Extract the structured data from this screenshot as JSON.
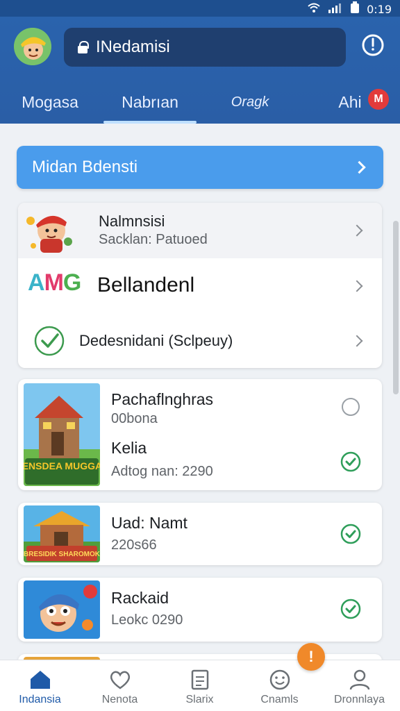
{
  "status_bar": {
    "time": "0:19"
  },
  "app_bar": {
    "url": "INedamisi"
  },
  "tabs": [
    {
      "label": "Mogasa"
    },
    {
      "label": "Nabrıan"
    },
    {
      "label": "Oragk"
    },
    {
      "label": "Ahi",
      "badge": "M"
    }
  ],
  "banner": {
    "label": "Midan Bdensti"
  },
  "list": {
    "items": [
      {
        "title": "Nalmnsisi",
        "subtitle": "Sacklan: Patuoed"
      },
      {
        "logo": "AMG",
        "title": "Bellandenl"
      },
      {
        "title": "Dedesnidani (Sclpeuy)"
      }
    ]
  },
  "games": [
    {
      "title": "Pachaflnghras",
      "subtitle": "00bona",
      "title2": "Kelia",
      "subtitle2": "Adtog nan: 2290",
      "image_text": "KENSDEA MUGGAS",
      "selected_top": false,
      "selected_bottom": true
    },
    {
      "title": "Uad: Namt",
      "subtitle": "220s66",
      "image_text": "BRESIDIK SHAROMOK",
      "selected": true
    },
    {
      "title": "Rackaid",
      "subtitle": "Leokc 0290",
      "selected": true
    }
  ],
  "fab": {
    "label": "!"
  },
  "bottom_nav": [
    {
      "label": "Indansia"
    },
    {
      "label": "Nenota"
    },
    {
      "label": "Slarix"
    },
    {
      "label": "Cnamls"
    },
    {
      "label": "Dronnlaya"
    }
  ],
  "colors": {
    "primary": "#2a63ad",
    "accent": "#4a9cec",
    "success": "#2f9e5a",
    "warning": "#f0892a"
  }
}
